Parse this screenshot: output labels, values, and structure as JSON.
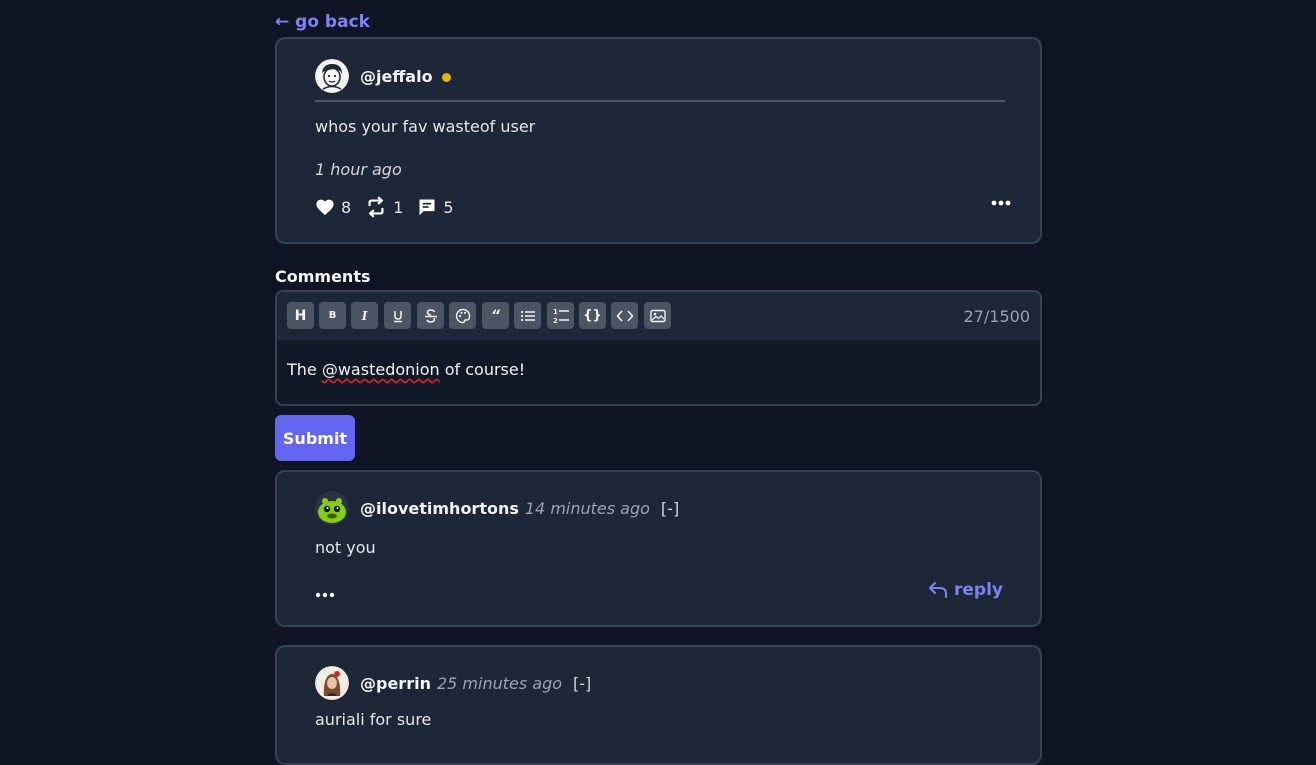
{
  "nav": {
    "go_back": "← go back"
  },
  "post": {
    "username": "@jeffalo",
    "content": "whos your fav wasteof user",
    "time": "1 hour ago",
    "likes": "8",
    "reposts": "1",
    "comments": "5",
    "online_color": "#eab308"
  },
  "comments_section": {
    "title": "Comments",
    "char_count": "27/1500",
    "editor_prefix": "The ",
    "editor_mention": "@wastedonion",
    "editor_suffix": " of course!",
    "submit_label": "Submit",
    "toolbar": [
      "heading-icon",
      "bold-icon",
      "italic-icon",
      "underline-icon",
      "strikethrough-icon",
      "color-palette-icon",
      "quote-icon",
      "bullet-list-icon",
      "numbered-list-icon",
      "code-block-icon",
      "inline-code-icon",
      "image-icon"
    ]
  },
  "comments": [
    {
      "username": "@ilovetimhortons",
      "time": "14 minutes ago",
      "collapse": "[-]",
      "text": "not you",
      "reply_label": "reply"
    },
    {
      "username": "@perrin",
      "time": "25 minutes ago",
      "collapse": "[-]",
      "text": "auriali for sure"
    }
  ],
  "colors": {
    "accent": "#6366f1",
    "link": "#7c83f2",
    "background": "#0f1524",
    "card": "#1e2737"
  }
}
